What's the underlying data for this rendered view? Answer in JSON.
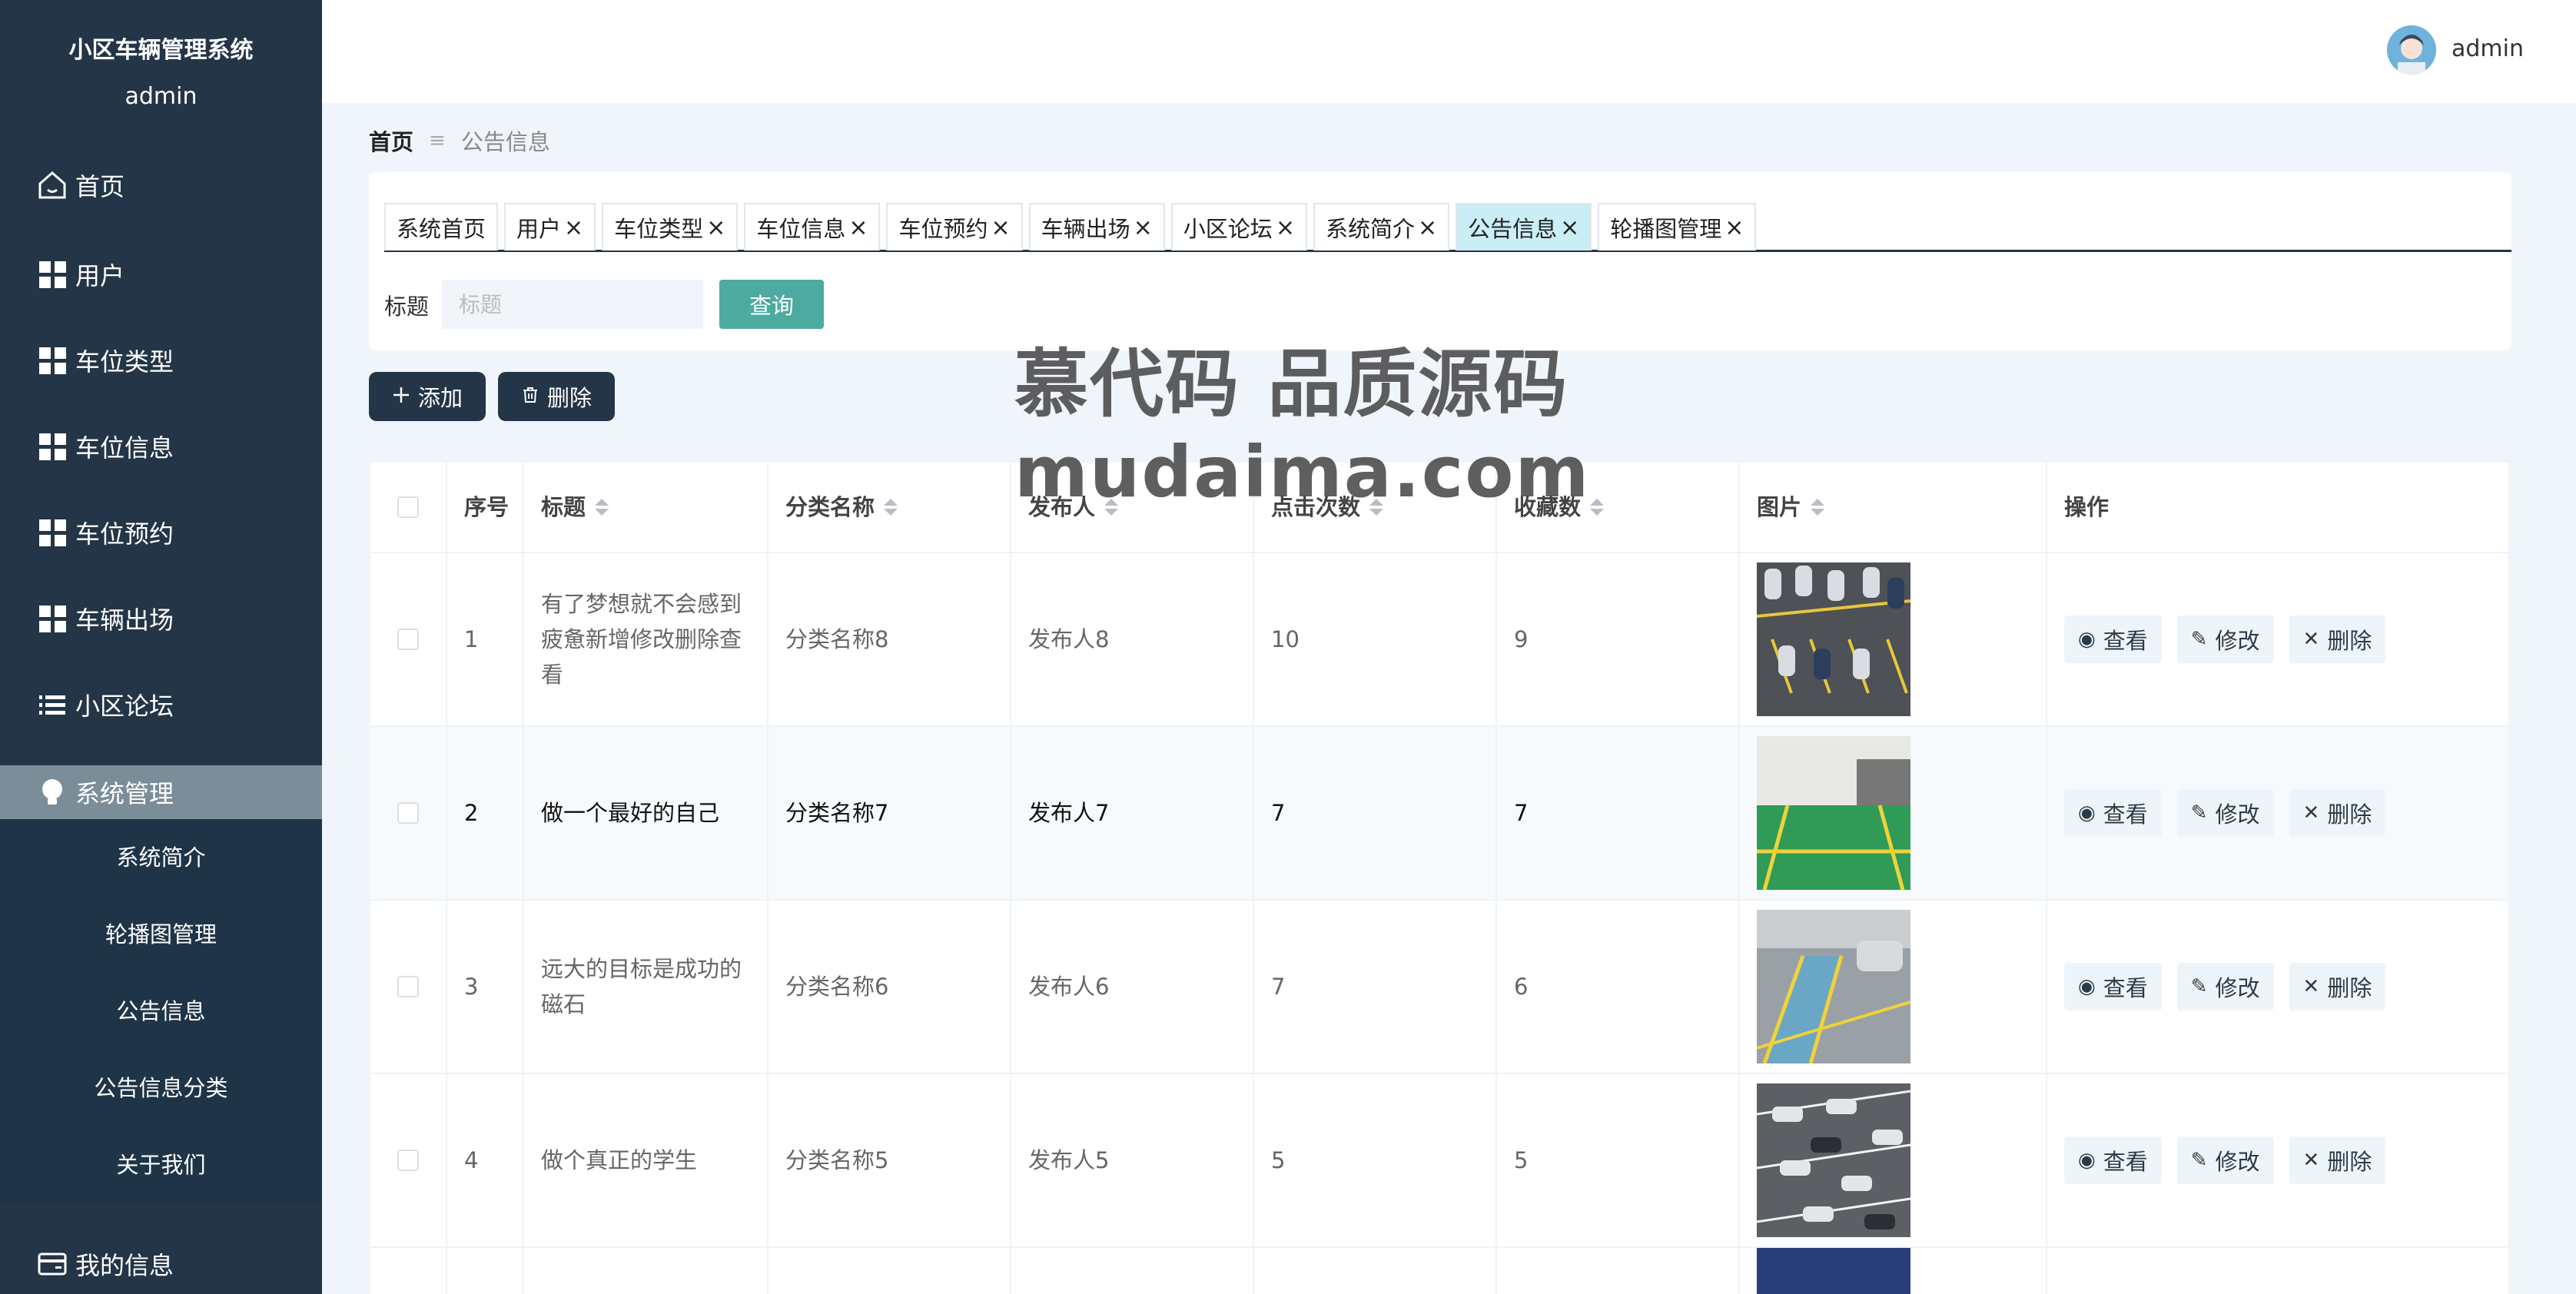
{
  "app": {
    "title": "小区车辆管理系统",
    "sidebar_user": "admin"
  },
  "sidebar": {
    "items": [
      {
        "label": "首页",
        "icon": "home-icon"
      },
      {
        "label": "用户",
        "icon": "grid-icon"
      },
      {
        "label": "车位类型",
        "icon": "grid-icon"
      },
      {
        "label": "车位信息",
        "icon": "grid-icon"
      },
      {
        "label": "车位预约",
        "icon": "grid-icon"
      },
      {
        "label": "车辆出场",
        "icon": "grid-icon"
      },
      {
        "label": "小区论坛",
        "icon": "list-icon"
      },
      {
        "label": "系统管理",
        "icon": "bulb-icon"
      },
      {
        "label": "我的信息",
        "icon": "card-icon"
      }
    ],
    "submenu": [
      "系统简介",
      "轮播图管理",
      "公告信息",
      "公告信息分类",
      "关于我们"
    ]
  },
  "header": {
    "user": "admin"
  },
  "breadcrumb": {
    "home": "首页",
    "separator": "≡",
    "current": "公告信息"
  },
  "tabs": [
    {
      "label": "系统首页",
      "closable": false
    },
    {
      "label": "用户",
      "closable": true
    },
    {
      "label": "车位类型",
      "closable": true
    },
    {
      "label": "车位信息",
      "closable": true
    },
    {
      "label": "车位预约",
      "closable": true
    },
    {
      "label": "车辆出场",
      "closable": true
    },
    {
      "label": "小区论坛",
      "closable": true
    },
    {
      "label": "系统简介",
      "closable": true
    },
    {
      "label": "公告信息",
      "closable": true,
      "active": true
    },
    {
      "label": "轮播图管理",
      "closable": true
    }
  ],
  "search": {
    "label": "标题",
    "placeholder": "标题",
    "button": "查询"
  },
  "actions": {
    "add": "添加",
    "delete": "删除"
  },
  "watermark": {
    "line1": "慕代码 品质源码",
    "line2": "mudaima.com"
  },
  "table": {
    "headers": [
      "序号",
      "标题",
      "分类名称",
      "发布人",
      "点击次数",
      "收藏数",
      "图片",
      "操作"
    ],
    "sortable": [
      false,
      true,
      true,
      true,
      true,
      true,
      true,
      false
    ],
    "rows": [
      {
        "index": "1",
        "title": "有了梦想就不会感到疲惫新增修改删除查看",
        "category": "分类名称8",
        "publisher": "发布人8",
        "clicks": "10",
        "favorites": "9"
      },
      {
        "index": "2",
        "title": "做一个最好的自己",
        "category": "分类名称7",
        "publisher": "发布人7",
        "clicks": "7",
        "favorites": "7"
      },
      {
        "index": "3",
        "title": "远大的目标是成功的磁石",
        "category": "分类名称6",
        "publisher": "发布人6",
        "clicks": "7",
        "favorites": "6"
      },
      {
        "index": "4",
        "title": "做个真正的学生",
        "category": "分类名称5",
        "publisher": "发布人5",
        "clicks": "5",
        "favorites": "5"
      }
    ],
    "row_actions": {
      "view": "查看",
      "edit": "修改",
      "delete": "删除"
    }
  },
  "colors": {
    "sidebar": "#233546",
    "sidebar_active": "#7b8d99",
    "accent": "#4daaa0",
    "active_tab": "#c9eef5"
  }
}
